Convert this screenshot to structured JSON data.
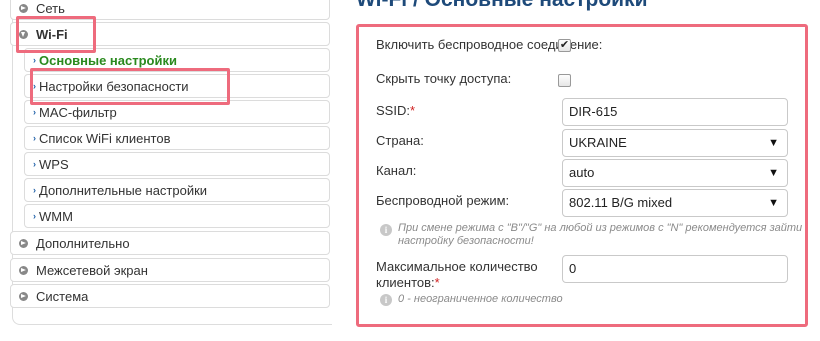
{
  "page_title": "Wi-Fi / Основные настройки",
  "nav": {
    "items": [
      {
        "label": "Сеть"
      },
      {
        "label": "Wi-Fi"
      },
      {
        "label": "Основные настройки"
      },
      {
        "label": "Настройки безопасности"
      },
      {
        "label": "MAC-фильтр"
      },
      {
        "label": "Список WiFi клиентов"
      },
      {
        "label": "WPS"
      },
      {
        "label": "Дополнительные настройки"
      },
      {
        "label": "WMM"
      },
      {
        "label": "Дополнительно"
      },
      {
        "label": "Межсетевой экран"
      },
      {
        "label": "Система"
      }
    ]
  },
  "form": {
    "enable_wireless": {
      "label": "Включить беспроводное соединение:",
      "checked": true
    },
    "hide_ap": {
      "label": "Скрыть точку доступа:",
      "checked": false
    },
    "ssid": {
      "label": "SSID:",
      "required_mark": "*",
      "value": "DIR-615"
    },
    "country": {
      "label": "Страна:",
      "value": "UKRAINE"
    },
    "channel": {
      "label": "Канал:",
      "value": "auto"
    },
    "wireless_mode": {
      "label": "Беспроводной режим:",
      "value": "802.11 B/G mixed"
    },
    "mode_hint_line1": "При смене режима с \"B\"/\"G\" на любой из режимов с \"N\" рекомендуется зайти",
    "mode_hint_line2": "настройку безопасности!",
    "max_clients": {
      "label": "Максимальное количество клиентов:",
      "required_mark": "*",
      "value": "0"
    },
    "max_clients_hint": "0 - неограниченное количество"
  },
  "colors": {
    "highlight": "#ee6b7d",
    "active_nav": "#2a8a1e",
    "title": "#1e4a7a",
    "required": "#d02020"
  },
  "icons": {
    "collapsed": "circle-arrow-right-icon",
    "expanded": "circle-arrow-down-icon",
    "sub_item": "chevron-right-icon",
    "info": "info-icon"
  }
}
